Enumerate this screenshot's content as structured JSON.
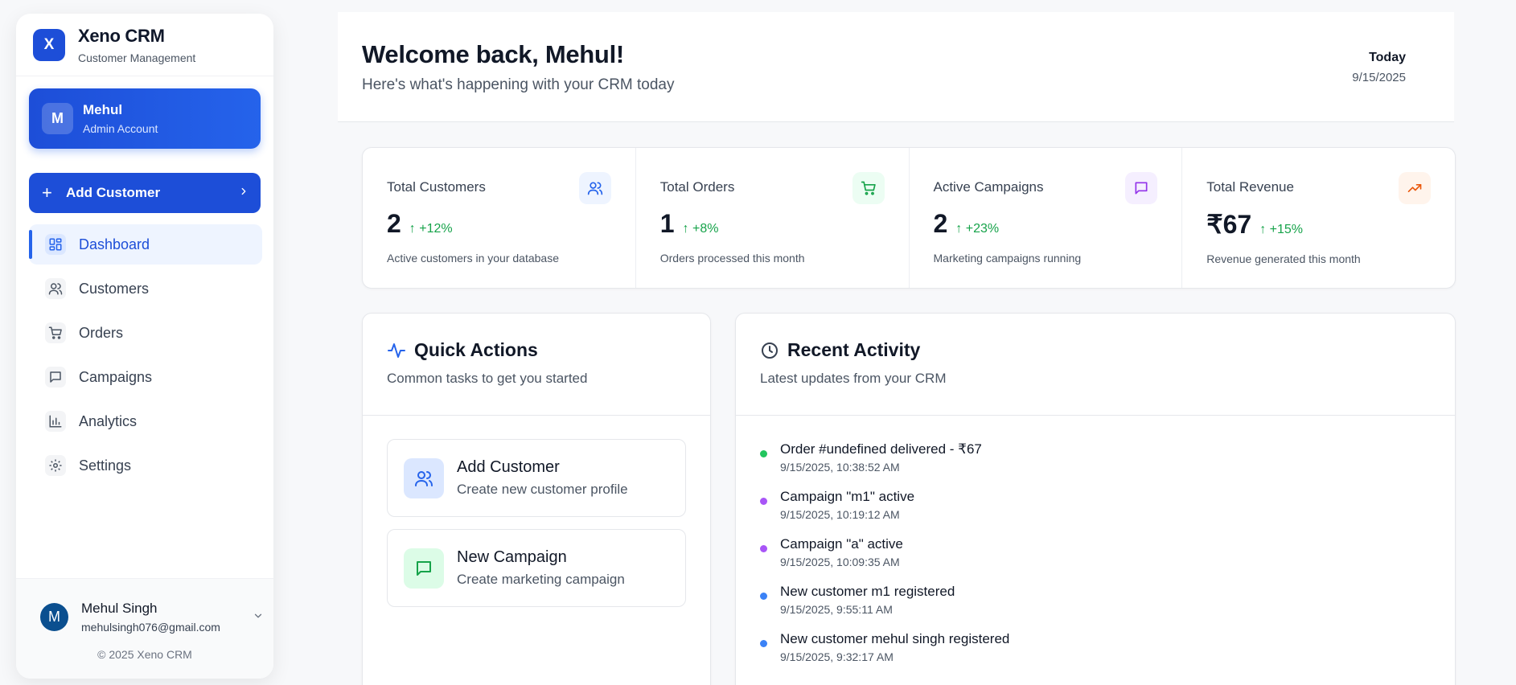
{
  "brand": {
    "logo_letter": "X",
    "title": "Xeno CRM",
    "subtitle": "Customer Management"
  },
  "account": {
    "initial": "M",
    "name": "Mehul",
    "role": "Admin Account"
  },
  "add_customer_button": {
    "label": "Add Customer"
  },
  "nav": {
    "items": [
      {
        "label": "Dashboard",
        "icon": "grid-icon",
        "active": true
      },
      {
        "label": "Customers",
        "icon": "users-icon"
      },
      {
        "label": "Orders",
        "icon": "cart-icon"
      },
      {
        "label": "Campaigns",
        "icon": "message-icon"
      },
      {
        "label": "Analytics",
        "icon": "bar-chart-icon"
      },
      {
        "label": "Settings",
        "icon": "gear-icon"
      }
    ]
  },
  "profile": {
    "initial": "M",
    "name": "Mehul Singh",
    "email": "mehulsingh076@gmail.com",
    "copyright": "© 2025 Xeno CRM"
  },
  "header": {
    "welcome": "Welcome back, Mehul!",
    "subtitle": "Here's what's happening with your CRM today",
    "today_label": "Today",
    "today_date": "9/15/2025"
  },
  "stats": [
    {
      "title": "Total Customers",
      "value": "2",
      "change": "+12%",
      "desc": "Active customers in your database",
      "icon": "users-icon",
      "color": "#2563eb",
      "bg": "#eef4ff"
    },
    {
      "title": "Total Orders",
      "value": "1",
      "change": "+8%",
      "desc": "Orders processed this month",
      "icon": "cart-icon",
      "color": "#16a34a",
      "bg": "#ecfdf3"
    },
    {
      "title": "Active Campaigns",
      "value": "2",
      "change": "+23%",
      "desc": "Marketing campaigns running",
      "icon": "message-icon",
      "color": "#9333ea",
      "bg": "#f5efff"
    },
    {
      "title": "Total Revenue",
      "value": "₹67",
      "change": "+15%",
      "desc": "Revenue generated this month",
      "icon": "trending-up-icon",
      "color": "#ea580c",
      "bg": "#fff4ec"
    }
  ],
  "quick_actions": {
    "title": "Quick Actions",
    "subtitle": "Common tasks to get you started",
    "items": [
      {
        "title": "Add Customer",
        "subtitle": "Create new customer profile",
        "icon": "users-icon"
      },
      {
        "title": "New Campaign",
        "subtitle": "Create marketing campaign",
        "icon": "message-icon"
      }
    ]
  },
  "recent_activity": {
    "title": "Recent Activity",
    "subtitle": "Latest updates from your CRM",
    "items": [
      {
        "title": "Order #undefined delivered - ₹67",
        "time": "9/15/2025, 10:38:52 AM",
        "color": "#22c55e"
      },
      {
        "title": "Campaign \"m1\" active",
        "time": "9/15/2025, 10:19:12 AM",
        "color": "#a855f7"
      },
      {
        "title": "Campaign \"a\" active",
        "time": "9/15/2025, 10:09:35 AM",
        "color": "#a855f7"
      },
      {
        "title": "New customer m1 registered",
        "time": "9/15/2025, 9:55:11 AM",
        "color": "#3b82f6"
      },
      {
        "title": "New customer mehul singh registered",
        "time": "9/15/2025, 9:32:17 AM",
        "color": "#3b82f6"
      }
    ]
  }
}
